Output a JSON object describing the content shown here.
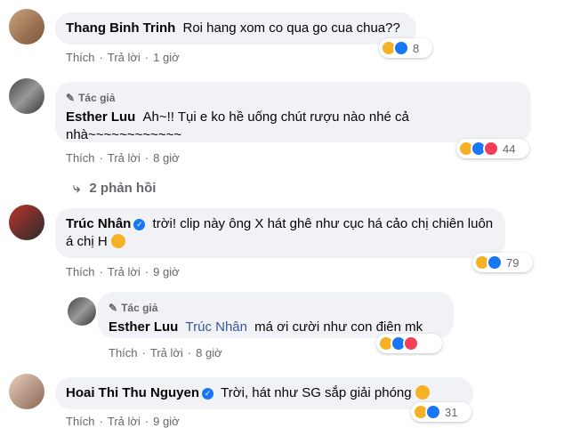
{
  "author_label": "Tác giả",
  "actions": {
    "like": "Thích",
    "reply": "Trả lời"
  },
  "comments": [
    {
      "name": "Thang Binh Trinh",
      "text": "Roi hang xom co qua go cua chua??",
      "time": "1 giờ",
      "reactions": "8"
    },
    {
      "name": "Esther Luu",
      "text": "Ah~!! Tụi e ko hề uống chút rượu nào nhé cả nhà~~~~~~~~~~~~",
      "time": "8 giờ",
      "reactions": "44"
    },
    {
      "name": "Trúc Nhân",
      "text": "trời! clip này ông X hát ghê như cục há cảo chị chiên luôn á chị H",
      "time": "9 giờ",
      "reactions": "79"
    },
    {
      "name": "Esther Luu",
      "mention": "Trúc Nhân",
      "text": "má ơi cười như con điên mk",
      "time": "8 giờ"
    },
    {
      "name": "Hoai Thi Thu Nguyen",
      "text": "Trời, hát như SG sắp giải phóng",
      "time": "9 giờ",
      "reactions": "31"
    }
  ],
  "replies_toggle": "2 phản hồi",
  "colors": {
    "accent": "#1877f2",
    "bubble": "#f0f2f5",
    "muted": "#65676b",
    "haha": "#f7b125",
    "love": "#f33e58"
  }
}
